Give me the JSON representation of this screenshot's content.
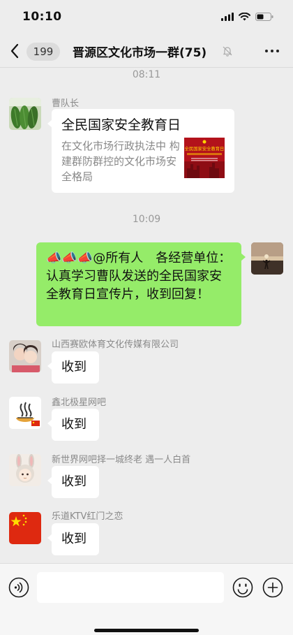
{
  "status_bar": {
    "time": "10:10"
  },
  "nav": {
    "unread_count": "199",
    "title": "晋源区文化市场一群(75)"
  },
  "messages": {
    "time_1": "08:11",
    "msg1": {
      "sender": "曹队长",
      "card_title": "全民国家安全教育日",
      "card_desc": "在文化市场行政执法中 构建群防群控的文化市场安全格局",
      "thumb_text": "全民国家安全教育日"
    },
    "time_2": "10:09",
    "msg2": {
      "icons": "📣📣📣",
      "text": "@所有人　各经营单位：认真学习曹队发送的全民国家安全教育日宣传片，收到回复！"
    },
    "msg3": {
      "sender": "山西赛欧体育文化传媒有限公司",
      "text": "收到"
    },
    "msg4": {
      "sender": "鑫北极星网吧",
      "text": "收到"
    },
    "msg5": {
      "sender": "新世界网吧择一城终老 遇一人白首",
      "text": "收到"
    },
    "msg6": {
      "sender": "乐道KTV红门之恋",
      "text": "收到"
    }
  },
  "colors": {
    "background": "#ededed",
    "self_bubble": "#95ec69",
    "other_bubble": "#ffffff"
  }
}
